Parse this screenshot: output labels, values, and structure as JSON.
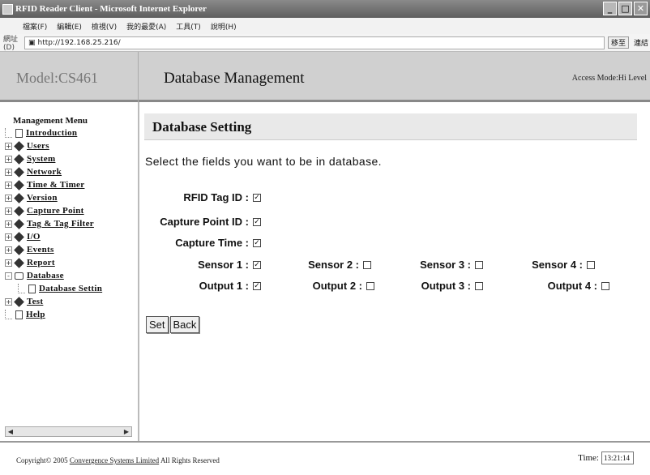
{
  "browser": {
    "title": "RFID Reader Client - Microsoft Internet Explorer",
    "menu": [
      "檔案(F)",
      "編輯(E)",
      "檢視(V)",
      "我的最愛(A)",
      "工具(T)",
      "說明(H)"
    ],
    "address_label": "網址(D)",
    "address": "http://192.168.25.216/",
    "go_label": "移至",
    "links_label": "連結",
    "window_buttons": {
      "minimize": "_",
      "maximize": "□",
      "close": "✕"
    }
  },
  "header": {
    "model": "Model:CS461",
    "page_title": "Database Management",
    "access_mode": "Access Mode:Hi Level"
  },
  "sidebar": {
    "heading": "Management Menu",
    "items": [
      {
        "label": "Introduction",
        "icon": "doc-icon",
        "expander": ""
      },
      {
        "label": "Users",
        "icon": "diamond-icon",
        "expander": "+"
      },
      {
        "label": "System",
        "icon": "diamond-icon",
        "expander": "+"
      },
      {
        "label": "Network",
        "icon": "diamond-icon",
        "expander": "+"
      },
      {
        "label": "Time & Timer",
        "icon": "diamond-icon",
        "expander": "+"
      },
      {
        "label": "Version",
        "icon": "diamond-icon",
        "expander": "+"
      },
      {
        "label": "Capture Point",
        "icon": "diamond-icon",
        "expander": "+"
      },
      {
        "label": "Tag & Tag Filter",
        "icon": "diamond-icon",
        "expander": "+"
      },
      {
        "label": "I/O",
        "icon": "diamond-icon",
        "expander": "+"
      },
      {
        "label": "Events",
        "icon": "diamond-icon",
        "expander": "+"
      },
      {
        "label": "Report",
        "icon": "diamond-icon",
        "expander": "+"
      },
      {
        "label": "Database",
        "icon": "folder-icon",
        "expander": "-"
      },
      {
        "label": "Database Settin",
        "icon": "doc-icon",
        "expander": ""
      },
      {
        "label": "Test",
        "icon": "diamond-icon",
        "expander": "+"
      },
      {
        "label": "Help",
        "icon": "doc-icon",
        "expander": ""
      }
    ]
  },
  "main": {
    "section_title": "Database Setting",
    "instruction": "Select the fields you want to be in database.",
    "fields": {
      "rfid_tag_id": {
        "label": "RFID Tag ID :",
        "checked": true
      },
      "capture_point_id": {
        "label": "Capture Point ID :",
        "checked": true
      },
      "capture_time": {
        "label": "Capture Time :",
        "checked": true
      },
      "sensor1": {
        "label": "Sensor 1 :",
        "checked": true
      },
      "sensor2": {
        "label": "Sensor 2 :",
        "checked": false
      },
      "sensor3": {
        "label": "Sensor 3 :",
        "checked": false
      },
      "sensor4": {
        "label": "Sensor 4 :",
        "checked": false
      },
      "output1": {
        "label": "Output 1 :",
        "checked": true
      },
      "output2": {
        "label": "Output 2 :",
        "checked": false
      },
      "output3": {
        "label": "Output 3 :",
        "checked": false
      },
      "output4": {
        "label": "Output 4 :",
        "checked": false
      }
    },
    "set_label": "Set",
    "back_label": "Back"
  },
  "footer": {
    "copyright_prefix": "Copyright© 2005",
    "company": "Convergence Systems Limited",
    "rights": "All Rights Reserved",
    "time_label": "Time:",
    "time_value": "13:21:14"
  }
}
